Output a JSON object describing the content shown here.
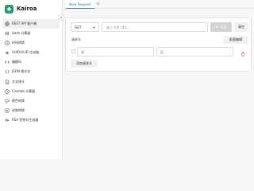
{
  "app": {
    "name": "Kairoa",
    "accent": "#1f9d6b"
  },
  "sidebar": {
    "items": [
      {
        "label": "REST API 客户端",
        "icon": "globe-icon",
        "active": true
      },
      {
        "label": "Hash 计算器",
        "icon": "hash-icon"
      },
      {
        "label": "时间转换",
        "icon": "clock-icon"
      },
      {
        "label": "UUID/ULID 生成器",
        "icon": "fingerprint-icon"
      },
      {
        "label": "编解码",
        "icon": "code-icon"
      },
      {
        "label": "JSON 格式化",
        "icon": "braces-icon"
      },
      {
        "label": "文本统计",
        "icon": "document-icon"
      },
      {
        "label": "Crontab 计算器",
        "icon": "clock-icon"
      },
      {
        "label": "颜色转换",
        "icon": "palette-icon"
      },
      {
        "label": "进制转换",
        "icon": "number-icon"
      },
      {
        "label": "RSA 密钥对生成器",
        "icon": "key-icon"
      }
    ]
  },
  "tabs": [
    {
      "label": "New Request"
    }
  ],
  "request": {
    "method": "GET",
    "url_placeholder": "输入 API URL...",
    "send_label": "发送",
    "clear_label": "清空",
    "params_label": "请求头",
    "bulk_edit_label": "批量编辑",
    "key_placeholder": "键",
    "value_placeholder": "值",
    "add_param_label": "添加请求头"
  }
}
